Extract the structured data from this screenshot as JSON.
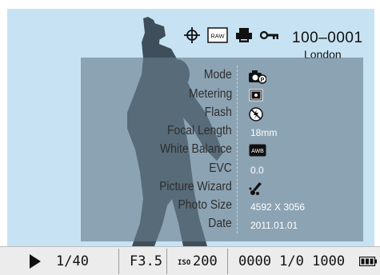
{
  "header": {
    "icons": [
      "target-crosshair-icon",
      "raw-quality-icon",
      "dpof-print-icon",
      "protect-key-icon"
    ],
    "raw_label": "RAW",
    "file_number": "100–0001",
    "location": "London"
  },
  "info": {
    "rows": [
      {
        "label": "Mode",
        "value": "",
        "icon": "camera-program-mode-icon"
      },
      {
        "label": "Metering",
        "value": "",
        "icon": "spot-metering-icon"
      },
      {
        "label": "Flash",
        "value": "",
        "icon": "flash-off-icon"
      },
      {
        "label": "Focal Length",
        "value": "18mm",
        "icon": ""
      },
      {
        "label": "White Balance",
        "value": "",
        "icon": "auto-white-balance-icon"
      },
      {
        "label": "EVC",
        "value": "0.0",
        "icon": ""
      },
      {
        "label": "Picture Wizard",
        "value": "",
        "icon": "picture-wizard-icon"
      },
      {
        "label": "Photo Size",
        "value": "4592 X 3056",
        "icon": ""
      },
      {
        "label": "Date",
        "value": "2011.01.01",
        "icon": ""
      }
    ],
    "awb_label": "AWB"
  },
  "bottom_bar": {
    "play_icon": "play-icon",
    "shutter": "1/40",
    "aperture": "F3.5",
    "iso_label": "ISO",
    "iso_value": "200",
    "image_count": "0000 1/0 1000",
    "battery_icon": "battery-full-icon"
  },
  "colors": {
    "lcd_background": "#c7e3f3",
    "panel_overlay": "#687c8a",
    "silhouette": "#3e4f5b",
    "bottom_bar": "#ececec"
  }
}
